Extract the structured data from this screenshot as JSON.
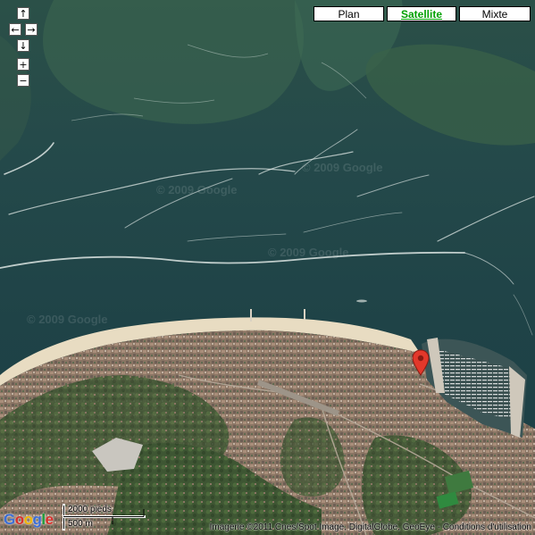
{
  "map_type_controls": [
    {
      "label": "Plan",
      "active": false
    },
    {
      "label": "Satellite",
      "active": true
    },
    {
      "label": "Mixte",
      "active": false
    }
  ],
  "nav_controls": {
    "pan_up_icon": "↑",
    "pan_left_icon": "←",
    "pan_right_icon": "→",
    "pan_down_icon": "↓",
    "zoom_in_icon": "+",
    "zoom_out_icon": "−"
  },
  "logo_letters": [
    "G",
    "o",
    "o",
    "g",
    "l",
    "e"
  ],
  "logo_colors": [
    "#3b6ed6",
    "#d8302b",
    "#f0b400",
    "#3b6ed6",
    "#1e9e3a",
    "#d8302b"
  ],
  "scale": {
    "imperial_label": "2000 pieds",
    "metric_label": "500 m"
  },
  "copyright": "Imagerie ©2011 Cnes/Spot Image, DigitalGlobe, GeoEye - Conditions d'utilisation",
  "watermark_text": "© 2009 Google",
  "marker": {
    "icon": "map-pin-icon",
    "color": "#e2382b"
  }
}
